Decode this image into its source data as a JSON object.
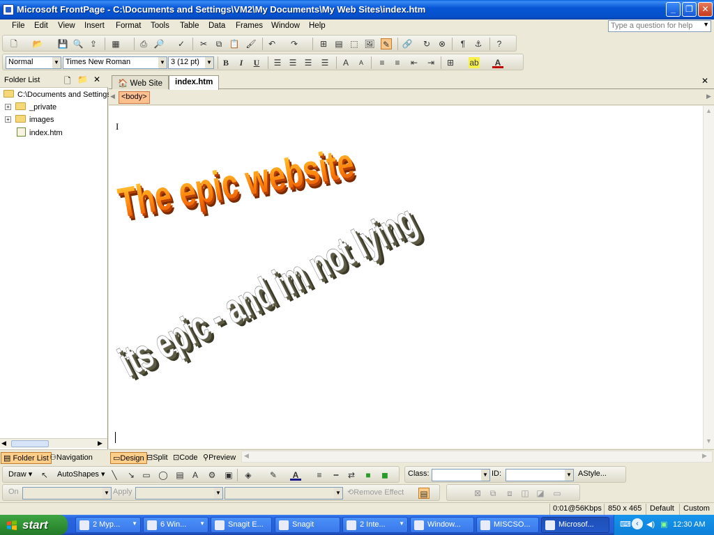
{
  "window": {
    "title": "Microsoft FrontPage - C:\\Documents and Settings\\VM2\\My Documents\\My Web Sites\\index.htm",
    "minimize_icon": "minimize-icon",
    "maximize_icon": "restore-icon",
    "close_icon": "close-icon"
  },
  "menu": {
    "items": [
      "File",
      "Edit",
      "View",
      "Insert",
      "Format",
      "Tools",
      "Table",
      "Data",
      "Frames",
      "Window",
      "Help"
    ],
    "ask_placeholder": "Type a question for help"
  },
  "format_toolbar": {
    "style_value": "Normal",
    "font_value": "Times New Roman",
    "size_value": "3  (12 pt)",
    "bold": "B",
    "italic": "I",
    "underline": "U"
  },
  "folder_panel": {
    "title": "Folder List",
    "root": "C:\\Documents and Settings",
    "items": [
      {
        "label": "_private",
        "type": "folder",
        "expandable": true
      },
      {
        "label": "images",
        "type": "folder",
        "expandable": true
      },
      {
        "label": "index.htm",
        "type": "page",
        "expandable": false
      }
    ],
    "tabs": [
      "Folder List",
      "Navigation"
    ]
  },
  "editor": {
    "tabs": [
      "Web Site",
      "index.htm"
    ],
    "active_tab": "index.htm",
    "quick_tag": "<body>",
    "wordart_1": "The epic website",
    "wordart_2": "its epic - and im not lying",
    "view_tabs": [
      "Design",
      "Split",
      "Code",
      "Preview"
    ],
    "active_view": "Design"
  },
  "bottom_toolbars": {
    "draw_label": "Draw",
    "autoshapes_label": "AutoShapes",
    "class_label": "Class:",
    "id_label": "ID:",
    "style_label": "Style...",
    "on_label": "On",
    "apply_label": "Apply",
    "remove_effect_label": "Remove Effect"
  },
  "statusbar": {
    "download": "0:01@56Kbps",
    "dimensions": "850 x 465",
    "mode": "Default",
    "custom": "Custom"
  },
  "taskbar": {
    "start_label": "start",
    "tasks": [
      "2 Myp...",
      "6 Win...",
      "Snagit E...",
      "Snagit",
      "2 Inte...",
      "Window...",
      "MISCSO...",
      "Microsof..."
    ],
    "active_task": "Microsof...",
    "clock": "12:30 AM"
  }
}
